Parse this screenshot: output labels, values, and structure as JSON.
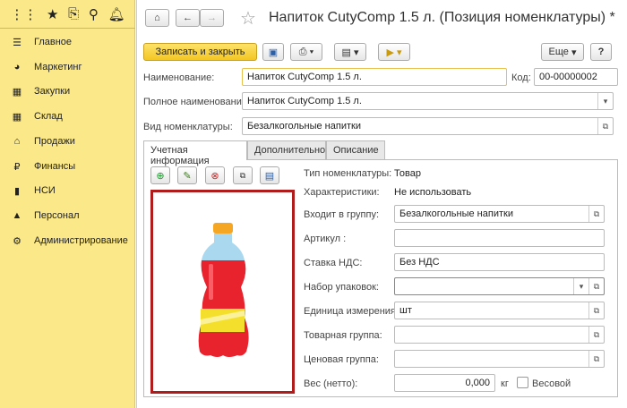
{
  "sidebar": {
    "items": [
      {
        "label": "Главное",
        "icon": "☰"
      },
      {
        "label": "Маркетинг",
        "icon": "◕"
      },
      {
        "label": "Закупки",
        "icon": "▦"
      },
      {
        "label": "Склад",
        "icon": "▦"
      },
      {
        "label": "Продажи",
        "icon": "⌂"
      },
      {
        "label": "Финансы",
        "icon": "₽"
      },
      {
        "label": "НСИ",
        "icon": "▮"
      },
      {
        "label": "Персонал",
        "icon": "▲"
      },
      {
        "label": "Администрирование",
        "icon": "⚙"
      }
    ]
  },
  "header": {
    "title": "Напиток CutyComp 1.5 л. (Позиция номенклатуры) *"
  },
  "toolbar": {
    "save_close": "Записать и закрыть",
    "more": "Еще",
    "help": "?"
  },
  "form": {
    "name_label": "Наименование:",
    "name_value": "Напиток CutyComp 1.5 л.",
    "code_label": "Код:",
    "code_value": "00-00000002",
    "fullname_label": "Полное наименование:",
    "fullname_value": "Напиток CutyComp 1.5 л.",
    "kind_label": "Вид номенклатуры:",
    "kind_value": "Безалкогольные напитки"
  },
  "tabs": [
    "Учетная информация",
    "Дополнительно",
    "Описание"
  ],
  "details": {
    "type_label": "Тип номенклатуры:",
    "type_value": "Товар",
    "char_label": "Характеристики:",
    "char_value": "Не использовать",
    "group_label": "Входит в группу:",
    "group_value": "Безалкогольные напитки",
    "article_label": "Артикул :",
    "article_value": "",
    "vat_label": "Ставка НДС:",
    "vat_value": "Без НДС",
    "pack_label": "Набор упаковок:",
    "pack_value": "",
    "unit_label": "Единица измерения:",
    "unit_value": "шт",
    "goods_group_label": "Товарная группа:",
    "goods_group_value": "",
    "price_group_label": "Ценовая группа:",
    "price_group_value": "",
    "weight_label": "Вес (нетто):",
    "weight_value": "0,000",
    "weight_unit": "кг",
    "weighted_label": "Весовой",
    "weighted_checked": false
  }
}
